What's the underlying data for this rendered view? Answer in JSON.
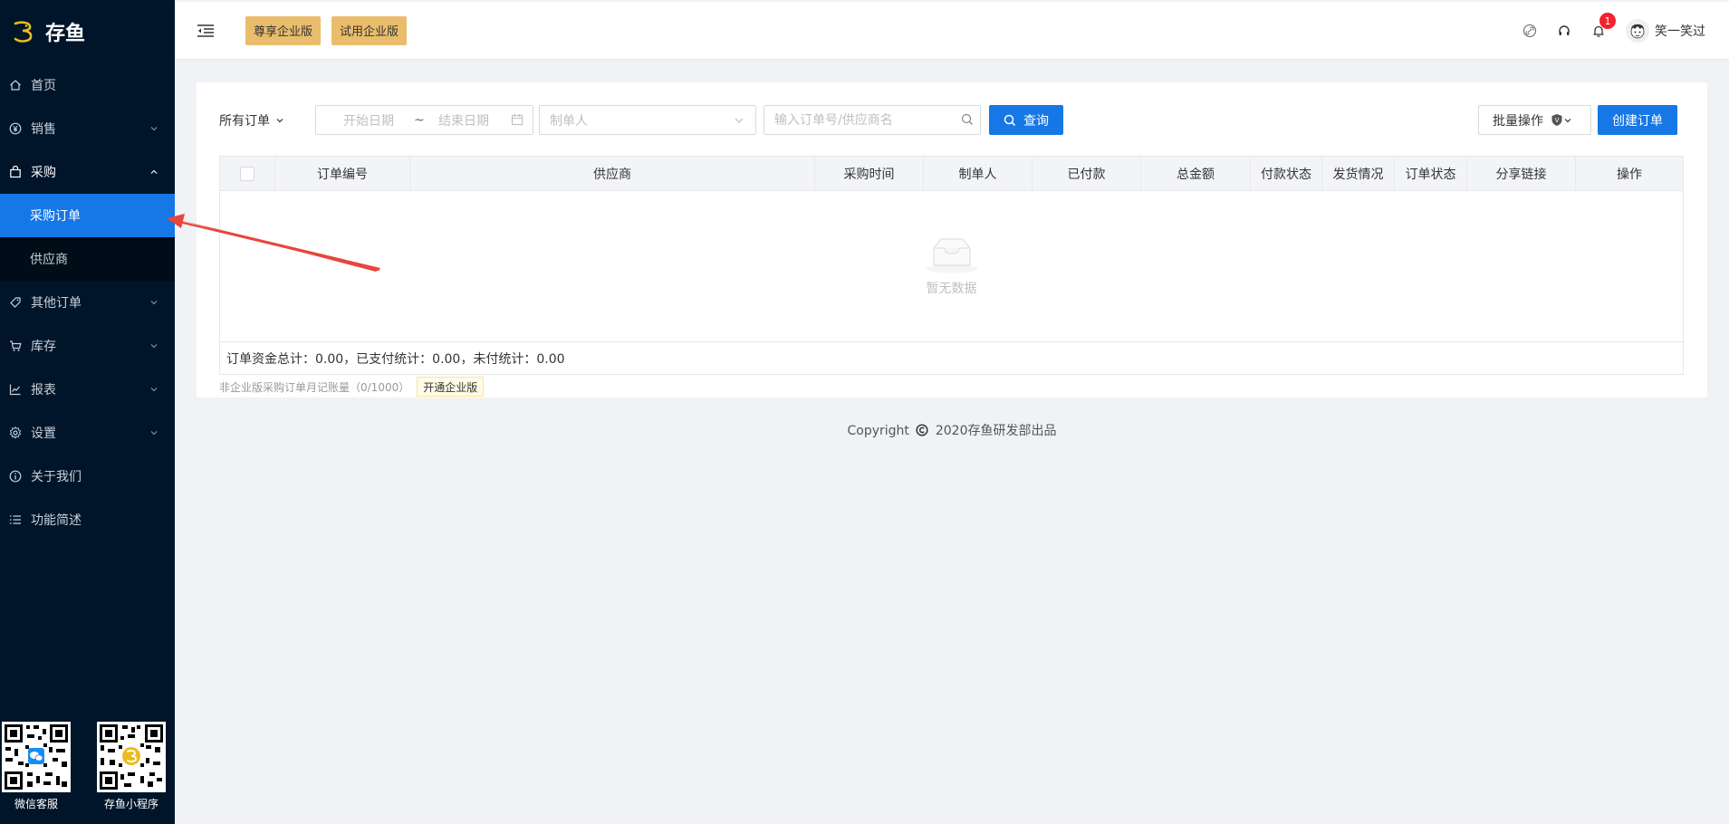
{
  "app": {
    "logo_text": "存鱼",
    "brand_color": "#e9bd1f"
  },
  "sidebar": {
    "items": [
      {
        "label": "首页",
        "icon": "home-icon"
      },
      {
        "label": "销售",
        "icon": "yen-icon"
      },
      {
        "label": "采购",
        "icon": "bag-icon",
        "expanded": true,
        "children": [
          {
            "label": "采购订单",
            "active": true
          },
          {
            "label": "供应商"
          }
        ]
      },
      {
        "label": "其他订单",
        "icon": "tag-icon"
      },
      {
        "label": "库存",
        "icon": "cart-icon"
      },
      {
        "label": "报表",
        "icon": "chart-line-icon"
      },
      {
        "label": "设置",
        "icon": "gear-icon"
      },
      {
        "label": "关于我们",
        "icon": "info-icon"
      },
      {
        "label": "功能简述",
        "icon": "list-icon"
      }
    ],
    "qr_codes": [
      {
        "label": "微信客服"
      },
      {
        "label": "存鱼小程序"
      }
    ]
  },
  "header": {
    "btn_premium": "尊享企业版",
    "btn_trial": "试用企业版",
    "notification_count": "1",
    "username": "笑一笑过"
  },
  "toolbar": {
    "all_orders": "所有订单",
    "start_date": "开始日期",
    "date_sep": "~",
    "end_date": "结束日期",
    "maker_placeholder": "制单人",
    "search_placeholder": "输入订单号/供应商名",
    "query_label": "查询",
    "batch_label": "批量操作",
    "create_label": "创建订单"
  },
  "table": {
    "columns": [
      "订单编号",
      "供应商",
      "采购时间",
      "制单人",
      "已付款",
      "总金额",
      "付款状态",
      "发货情况",
      "订单状态",
      "分享链接",
      "操作"
    ],
    "empty_text": "暂无数据",
    "summary": "订单资金总计：0.00，已支付统计：0.00，未付统计：0.00"
  },
  "note": {
    "text": "非企业版采购订单月记账量（0/1000）",
    "button": "开通企业版"
  },
  "footer": {
    "copyright": "Copyright",
    "copyright_rest": "2020存鱼研发部出品"
  },
  "colors": {
    "sidebar_bg": "#001529",
    "primary": "#1677e6",
    "enterprise": "#e9bd6b",
    "arrow": "#e8453c"
  }
}
